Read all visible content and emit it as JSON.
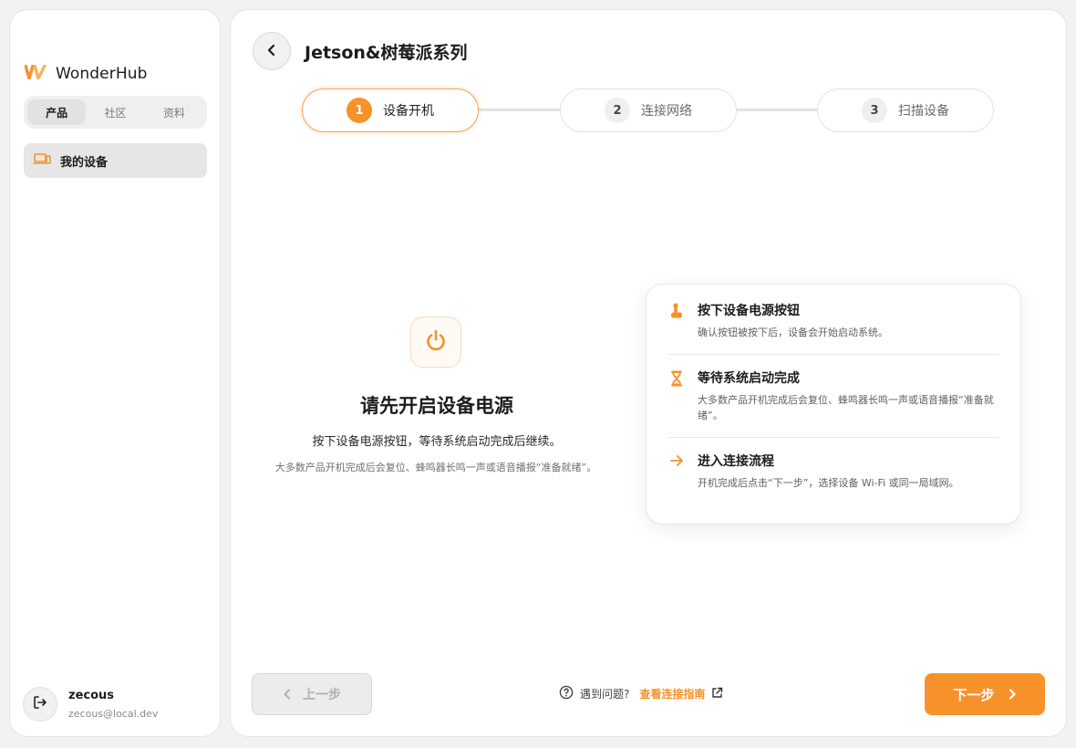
{
  "colors": {
    "accent": "#F5922A",
    "background": "#F2F2F2",
    "surface": "#FFFFFF"
  },
  "brand": {
    "name": "WonderHub",
    "logo_icon": "wonderhub-logo"
  },
  "sidebar": {
    "segments": [
      {
        "label": "产品",
        "active": true
      },
      {
        "label": "社区",
        "active": false
      },
      {
        "label": "资料",
        "active": false
      }
    ],
    "nav_items": [
      {
        "label": "我的设备",
        "icon": "devices-icon",
        "active": true
      }
    ]
  },
  "user": {
    "name": "zecous",
    "email": "zecous@local.dev",
    "logout_icon": "logout-icon"
  },
  "header": {
    "title": "Jetson&树莓派系列",
    "back_icon": "chevron-left-icon"
  },
  "stepper": {
    "steps": [
      {
        "number": "1",
        "label": "设备开机",
        "active": true
      },
      {
        "number": "2",
        "label": "连接网络",
        "active": false
      },
      {
        "number": "3",
        "label": "扫描设备",
        "active": false
      }
    ]
  },
  "hero": {
    "icon": "power-icon",
    "title": "请先开启设备电源",
    "subtitle": "按下设备电源按钮，等待系统启动完成后继续。",
    "note": "大多数产品开机完成后会复位、蜂鸣器长鸣一声或语音播报“准备就绪”。"
  },
  "info": {
    "items": [
      {
        "icon": "press-button-icon",
        "title": "按下设备电源按钮",
        "desc": "确认按钮被按下后，设备会开始启动系统。"
      },
      {
        "icon": "hourglass-icon",
        "title": "等待系统启动完成",
        "desc": "大多数产品开机完成后会复位、蜂鸣器长鸣一声或语音播报“准备就绪”。"
      },
      {
        "icon": "arrow-right-icon",
        "title": "进入连接流程",
        "desc": "开机完成后点击“下一步”，选择设备 Wi-Fi 或同一局域网。"
      }
    ]
  },
  "footer": {
    "prev_label": "上一步",
    "next_label": "下一步",
    "help_text": "遇到问题?",
    "help_link": "查看连接指南"
  }
}
